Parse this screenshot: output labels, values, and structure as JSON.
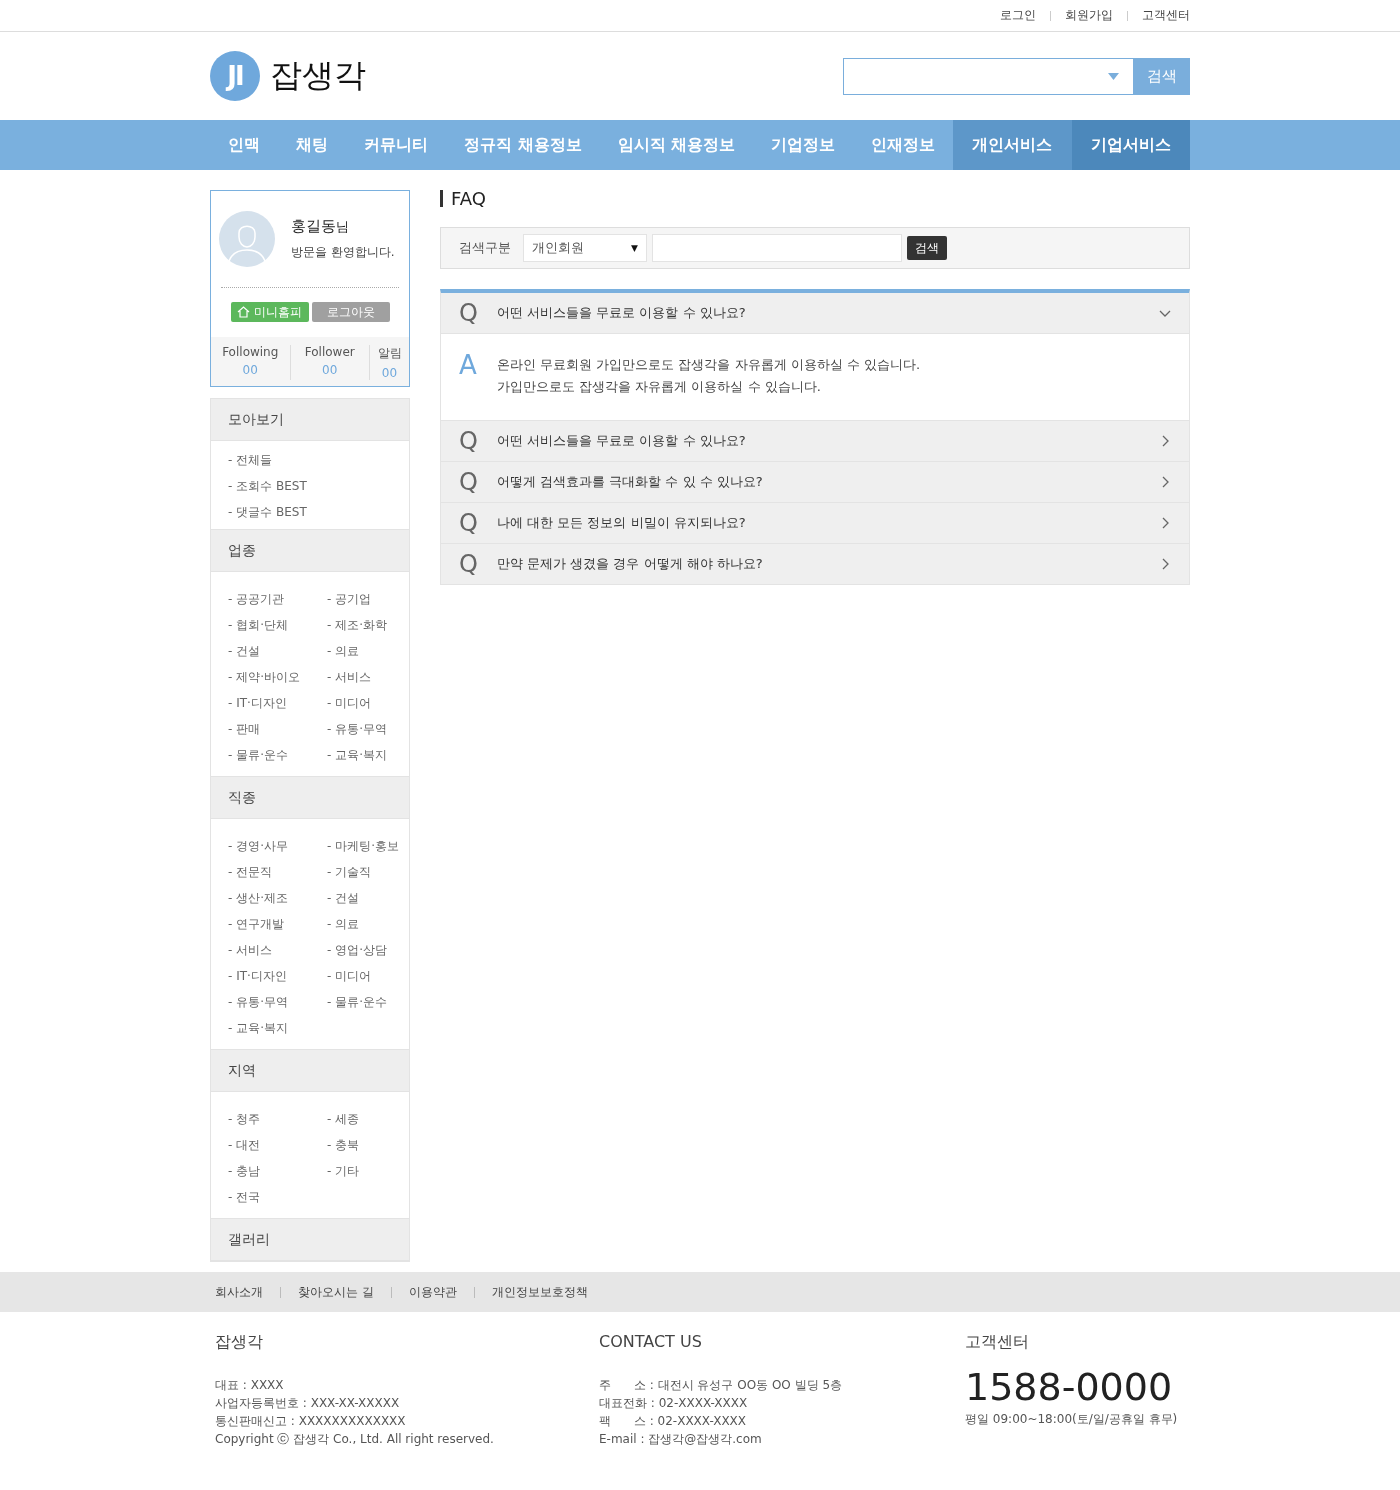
{
  "top_links": [
    "로그인",
    "회원가입",
    "고객센터"
  ],
  "logo": {
    "mark": "JI",
    "name": "잡생각"
  },
  "header_search": {
    "button": "검색"
  },
  "nav": [
    {
      "label": "인맥",
      "kind": "plain"
    },
    {
      "label": "채팅",
      "kind": "plain"
    },
    {
      "label": "커뮤니티",
      "kind": "plain"
    },
    {
      "label": "정규직 채용정보",
      "kind": "plain"
    },
    {
      "label": "임시직 채용정보",
      "kind": "plain"
    },
    {
      "label": "기업정보",
      "kind": "plain"
    },
    {
      "label": "인재정보",
      "kind": "plain"
    },
    {
      "label": "개인서비스",
      "kind": "service"
    },
    {
      "label": "기업서비스",
      "kind": "service-dark"
    }
  ],
  "profile": {
    "name": "홍길동",
    "suffix": "님",
    "greeting": "방문을 환영합니다.",
    "buttons": [
      "미니홈피",
      "로그아웃"
    ],
    "stats": [
      {
        "label": "Following",
        "value": "00"
      },
      {
        "label": "Follower",
        "value": "00"
      },
      {
        "label": "알림",
        "value": "00"
      }
    ]
  },
  "sidebar": [
    {
      "title": "모아보기",
      "kind": "list",
      "items": [
        "- 전체들",
        "- 조회수 BEST",
        "- 댓글수 BEST"
      ]
    },
    {
      "title": "업종",
      "kind": "grid",
      "items": [
        "- 공공기관",
        "- 공기업",
        "- 협회·단체",
        "- 제조·화학",
        "- 건설",
        "- 의료",
        "- 제약·바이오",
        "- 서비스",
        "- IT·디자인",
        "- 미디어",
        "- 판매",
        "- 유통·무역",
        "- 물류·운수",
        "- 교육·복지"
      ]
    },
    {
      "title": "직종",
      "kind": "grid",
      "items": [
        "- 경영·사무",
        "- 마케팅·홍보",
        "- 전문직",
        "- 기술직",
        "- 생산·제조",
        "- 건설",
        "- 연구개발",
        "- 의료",
        "- 서비스",
        "- 영업·상담",
        "- IT·디자인",
        "- 미디어",
        "- 유통·무역",
        "- 물류·운수",
        "- 교육·복지"
      ]
    },
    {
      "title": "지역",
      "kind": "grid",
      "items": [
        "- 청주",
        "- 세종",
        "- 대전",
        "- 충북",
        "- 충남",
        "- 기타",
        "- 전국"
      ]
    },
    {
      "title": "갤러리",
      "kind": "title"
    }
  ],
  "faq": {
    "title": "FAQ",
    "search_label": "검색구분",
    "select_value": "개인회원",
    "select_caret": "▼",
    "button": "검색",
    "items": [
      {
        "marker": "Q",
        "question": "어떤 서비스들을 무료로 이용할 수 있나요?",
        "expanded": true,
        "answer_marker": "A",
        "answer": [
          "온라인 무료회원 가입만으로도 잡생각을 자유롭게 이용하실 수 있습니다.",
          "가입만으로도 잡생각을 자유롭게 이용하실 수 있습니다."
        ]
      },
      {
        "marker": "Q",
        "question": "어떤 서비스들을 무료로 이용할 수 있나요?",
        "expanded": false
      },
      {
        "marker": "Q",
        "question": "어떻게 검색효과를 극대화할 수 있 수 있나요?",
        "expanded": false
      },
      {
        "marker": "Q",
        "question": "나에 대한 모든 정보의 비밀이 유지되나요?",
        "expanded": false
      },
      {
        "marker": "Q",
        "question": "만약 문제가 생겼을 경우 어떻게 해야 하나요?",
        "expanded": false
      }
    ]
  },
  "footer": {
    "links": [
      "회사소개",
      "찾아오시는 길",
      "이용약관",
      "개인정보보호정책"
    ],
    "columns": [
      {
        "title": "잡생각",
        "kind": "lines",
        "lines": [
          "대표 : XXXX",
          "사업자등록번호 : XXX-XX-XXXXX",
          "통신판매신고 : XXXXXXXXXXXXX",
          "Copyright ⓒ 잡생각 Co., Ltd. All right reserved."
        ]
      },
      {
        "title": "CONTACT US",
        "kind": "lines",
        "lines": [
          "주      소 : 대전시 유성구 OO동 OO 빌딩 5층",
          "대표전화 : 02-XXXX-XXXX",
          "팩      스 : 02-XXXX-XXXX",
          "E-mail : 잡생각@잡생각.com"
        ]
      },
      {
        "title": "고객센터",
        "kind": "phone",
        "phone": "1588-0000",
        "lines": [
          "평일 09:00~18:00(토/일/공휴일 휴무)"
        ]
      }
    ]
  }
}
